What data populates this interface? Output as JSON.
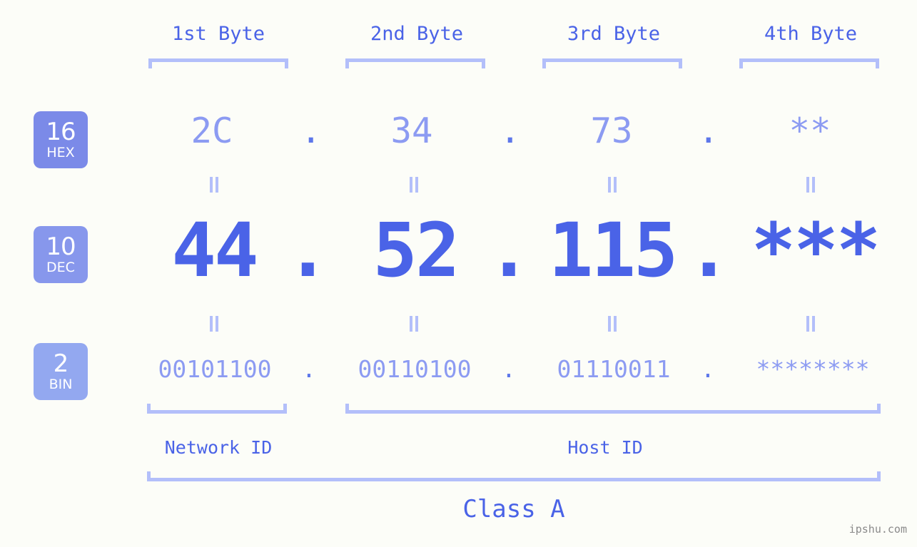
{
  "page": {
    "background_color": "#fcfdf8",
    "accent_color": "#4a63e7",
    "muted_accent_color": "#8c9bf2",
    "bracket_color": "#b3bffa",
    "watermark": "ipshu.com"
  },
  "byte_headers": [
    {
      "label": "1st Byte"
    },
    {
      "label": "2nd Byte"
    },
    {
      "label": "3rd Byte"
    },
    {
      "label": "4th Byte"
    }
  ],
  "radix_badges": [
    {
      "number": "16",
      "name": "HEX",
      "color": "#7b8ae8"
    },
    {
      "number": "10",
      "name": "DEC",
      "color": "#8797ec"
    },
    {
      "number": "2",
      "name": "BIN",
      "color": "#93a8f0"
    }
  ],
  "rows": {
    "hex": {
      "radix": "16",
      "values": [
        "2C",
        "34",
        "73",
        "**"
      ],
      "separator": "."
    },
    "dec": {
      "radix": "10",
      "values": [
        "44",
        "52",
        "115",
        "***"
      ],
      "separator": "."
    },
    "bin": {
      "radix": "2",
      "values": [
        "00101100",
        "00110100",
        "01110011",
        "********"
      ],
      "separator": "."
    }
  },
  "separators": {
    "dot": "."
  },
  "id_sections": [
    {
      "label": "Network ID"
    },
    {
      "label": "Host ID"
    }
  ],
  "class": {
    "label": "Class A"
  }
}
